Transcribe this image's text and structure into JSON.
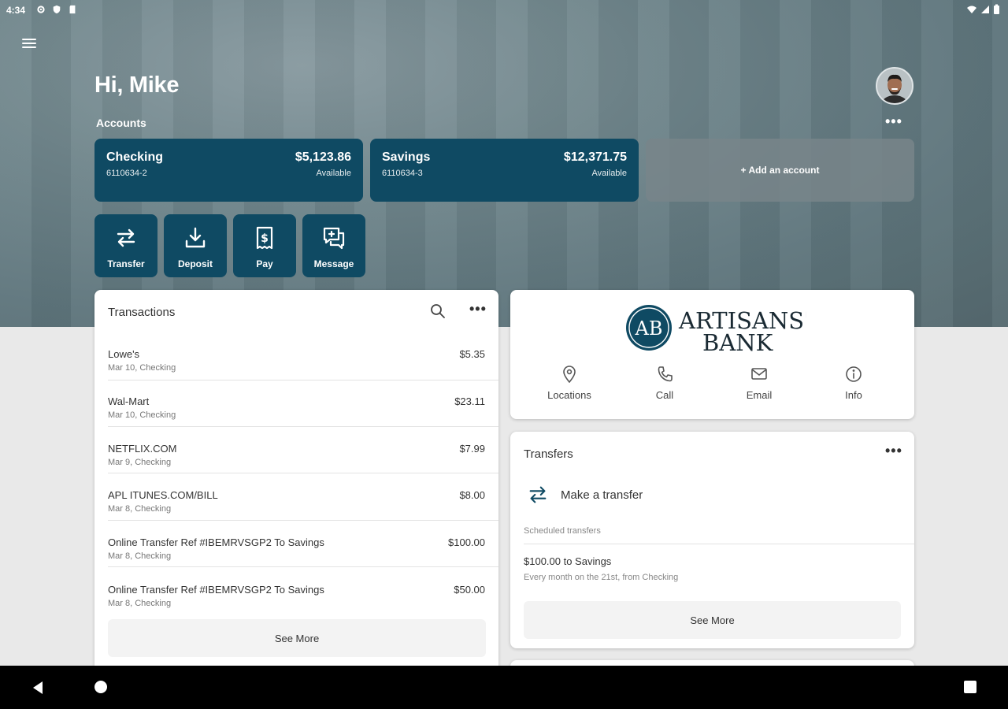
{
  "status_bar": {
    "time": "4:34"
  },
  "header": {
    "greeting": "Hi, Mike",
    "accounts_label": "Accounts",
    "more": "•••"
  },
  "accounts": [
    {
      "name": "Checking",
      "number": "6110634-2",
      "balance": "$5,123.86",
      "balance_label": "Available"
    },
    {
      "name": "Savings",
      "number": "6110634-3",
      "balance": "$12,371.75",
      "balance_label": "Available"
    }
  ],
  "add_account_label": "+ Add an account",
  "quick_actions": [
    {
      "label": "Transfer",
      "icon": "transfer-icon"
    },
    {
      "label": "Deposit",
      "icon": "deposit-icon"
    },
    {
      "label": "Pay",
      "icon": "pay-icon"
    },
    {
      "label": "Message",
      "icon": "message-icon"
    }
  ],
  "transactions": {
    "title": "Transactions",
    "more": "•••",
    "items": [
      {
        "name": "Lowe's",
        "sub": "Mar 10, Checking",
        "amount": "$5.35"
      },
      {
        "name": "Wal-Mart",
        "sub": "Mar 10, Checking",
        "amount": "$23.11"
      },
      {
        "name": "NETFLIX.COM",
        "sub": "Mar 9, Checking",
        "amount": "$7.99"
      },
      {
        "name": "APL ITUNES.COM/BILL",
        "sub": "Mar 8, Checking",
        "amount": "$8.00"
      },
      {
        "name": "Online Transfer Ref #IBEMRVSGP2 To Savings",
        "sub": "Mar 8, Checking",
        "amount": "$100.00"
      },
      {
        "name": "Online Transfer Ref #IBEMRVSGP2 To Savings",
        "sub": "Mar 8, Checking",
        "amount": "$50.00"
      }
    ],
    "see_more": "See More"
  },
  "bank": {
    "logo_monogram": "AB",
    "logo_line1": "ARTISANS'",
    "logo_line2": "BANK",
    "actions": [
      {
        "label": "Locations",
        "icon": "location-pin-icon"
      },
      {
        "label": "Call",
        "icon": "phone-icon"
      },
      {
        "label": "Email",
        "icon": "email-icon"
      },
      {
        "label": "Info",
        "icon": "info-icon"
      }
    ]
  },
  "transfers": {
    "title": "Transfers",
    "more": "•••",
    "make_transfer": "Make a transfer",
    "scheduled_label": "Scheduled transfers",
    "scheduled": [
      {
        "name": "$100.00 to Savings",
        "sub": "Every month on the 21st, from Checking"
      }
    ],
    "see_more": "See More"
  },
  "colors": {
    "primary": "#0f4a63",
    "hero": "#6f858b",
    "card": "#ffffff",
    "background": "#e9e9e9"
  }
}
